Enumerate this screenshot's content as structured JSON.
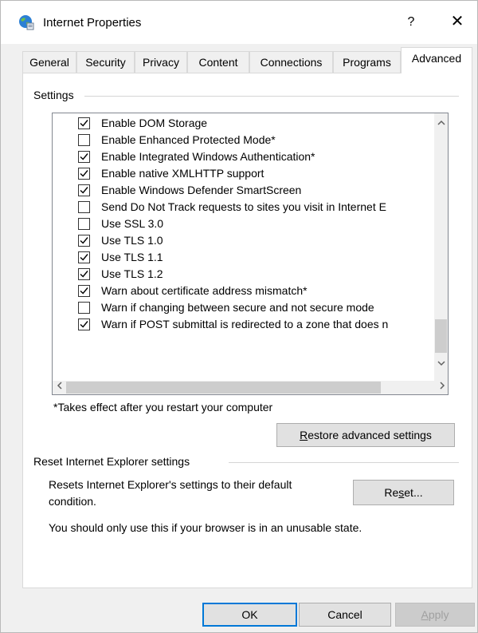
{
  "window": {
    "title": "Internet Properties",
    "help_glyph": "?",
    "close_glyph": "✕"
  },
  "tabs": [
    {
      "label": "General"
    },
    {
      "label": "Security"
    },
    {
      "label": "Privacy"
    },
    {
      "label": "Content"
    },
    {
      "label": "Connections"
    },
    {
      "label": "Programs"
    },
    {
      "label": "Advanced",
      "active": true
    }
  ],
  "settings": {
    "group_label": "Settings",
    "items": [
      {
        "label": "Enable DOM Storage",
        "checked": true
      },
      {
        "label": "Enable Enhanced Protected Mode*",
        "checked": false
      },
      {
        "label": "Enable Integrated Windows Authentication*",
        "checked": true
      },
      {
        "label": "Enable native XMLHTTP support",
        "checked": true
      },
      {
        "label": "Enable Windows Defender SmartScreen",
        "checked": true
      },
      {
        "label": "Send Do Not Track requests to sites you visit in Internet E",
        "checked": false
      },
      {
        "label": "Use SSL 3.0",
        "checked": false
      },
      {
        "label": "Use TLS 1.0",
        "checked": true
      },
      {
        "label": "Use TLS 1.1",
        "checked": true
      },
      {
        "label": "Use TLS 1.2",
        "checked": true
      },
      {
        "label": "Warn about certificate address mismatch*",
        "checked": true
      },
      {
        "label": "Warn if changing between secure and not secure mode",
        "checked": false
      },
      {
        "label": "Warn if POST submittal is redirected to a zone that does n",
        "checked": true
      }
    ],
    "restart_note": "*Takes effect after you restart your computer",
    "restore_button": {
      "prefix": "",
      "accel": "R",
      "suffix": "estore advanced settings"
    }
  },
  "reset": {
    "group_label": "Reset Internet Explorer settings",
    "description_line1": "Resets Internet Explorer's settings to their default",
    "description_line2": "condition.",
    "reset_button": {
      "prefix": "Re",
      "accel": "s",
      "suffix": "et..."
    },
    "warning": "You should only use this if your browser is in an unusable state."
  },
  "footer": {
    "ok_label": "OK",
    "cancel_label": "Cancel",
    "apply_button": {
      "prefix": "",
      "accel": "A",
      "suffix": "pply"
    }
  },
  "colors": {
    "accent": "#0078d7",
    "dialog_bg": "#f0f0f0"
  }
}
